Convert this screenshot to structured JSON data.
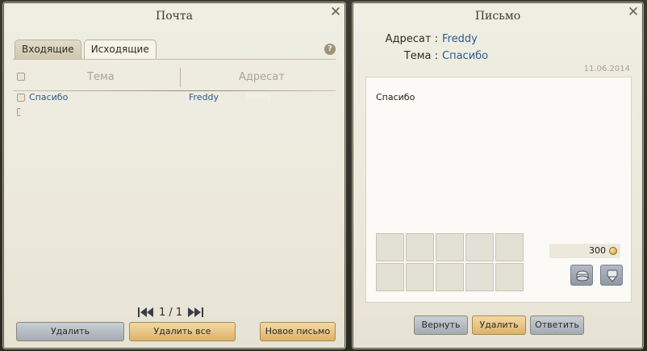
{
  "mail": {
    "title": "Почта",
    "tabs": [
      {
        "label": "Входящие"
      },
      {
        "label": "Исходящие"
      }
    ],
    "help": "?",
    "columns": {
      "subject": "Тема",
      "recipient": "Адресат"
    },
    "rows": [
      {
        "subject": "Спасибо",
        "recipient": "Freddy",
        "recipient_shadow": "freddy"
      }
    ],
    "pager": {
      "text": "1 / 1"
    },
    "buttons": {
      "delete": "Удалить",
      "delete_all": "Удалить все",
      "new_mail": "Новое письмо"
    }
  },
  "letter": {
    "title": "Письмо",
    "recipient_label": "Адресат :",
    "recipient_value": "Freddy",
    "subject_label": "Тема :",
    "subject_value": "Спасибо",
    "date": "11.06.2014",
    "body": "Спасибо",
    "money": "300",
    "buttons": {
      "return": "Вернуть",
      "delete": "Удалить",
      "reply": "Ответить"
    }
  },
  "colors": {
    "link": "#2c5a8c",
    "gold_button": "#dcb26b",
    "grey_button": "#a3abb5"
  },
  "icons": [
    "close-icon",
    "help-icon",
    "first-page-icon",
    "prev-page-icon",
    "next-page-icon",
    "last-page-icon",
    "coin-icon",
    "take-money-icon",
    "take-items-icon"
  ]
}
